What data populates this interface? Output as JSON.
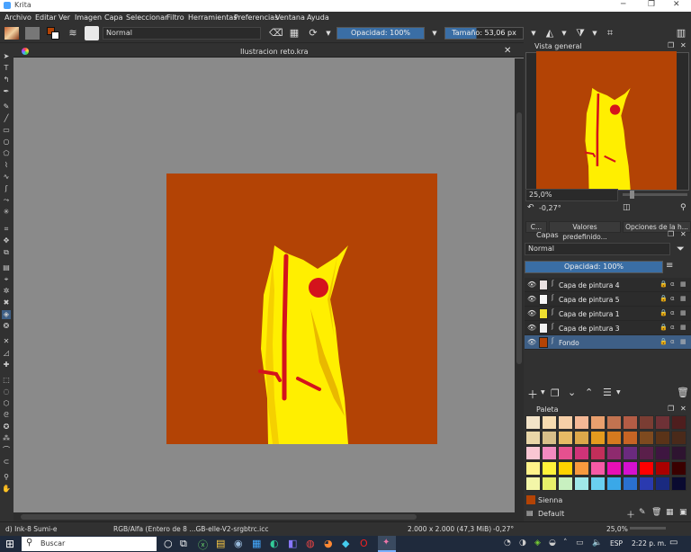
{
  "app": {
    "title": "Krita"
  },
  "menu": [
    "Archivo",
    "Editar",
    "Ver",
    "Imagen",
    "Capa",
    "Seleccionar",
    "Filtro",
    "Herramientas",
    "Preferencias",
    "Ventana",
    "Ayuda"
  ],
  "toolbar": {
    "blend_mode": "Normal",
    "opacity": "Opacidad: 100%",
    "size": "Tamaño: 53,06 px"
  },
  "document": {
    "tab_title": "Ilustracion reto.kra"
  },
  "overview": {
    "title": "Vista general",
    "zoom": "25,0%",
    "rotation": "-0,27°"
  },
  "dock_tabs": [
    "C...",
    "Valores predefinido...",
    "Opciones de la h..."
  ],
  "layers": {
    "title": "Capas",
    "blend": "Normal",
    "opacity": "Opacidad:  100%",
    "items": [
      {
        "name": "Capa de pintura 4",
        "thumb": "#e8e0e0"
      },
      {
        "name": "Capa de pintura 5",
        "thumb": "#f5f5f5"
      },
      {
        "name": "Capa de pintura 1",
        "thumb": "#f0e030"
      },
      {
        "name": "Capa de pintura 3",
        "thumb": "#f2f2f2"
      },
      {
        "name": "Fondo",
        "thumb": "#b34305"
      }
    ]
  },
  "palette": {
    "title": "Paleta",
    "selected_color_name": "Sienna",
    "selected_color": "#b34305",
    "name": "Default",
    "colors": [
      "#f2e3c8",
      "#f7dcb0",
      "#f6cfa8",
      "#f4b896",
      "#e9a06e",
      "#c27350",
      "#b35c45",
      "#7a3d33",
      "#6e3136",
      "#4e1e1e",
      "#e9d6a8",
      "#d8bf8a",
      "#e7ba65",
      "#dda84a",
      "#e59b1e",
      "#d57a1e",
      "#c76424",
      "#7e4a1f",
      "#5a3318",
      "#4a2a1a",
      "#f9c6d3",
      "#f28ac0",
      "#e6508f",
      "#d03378",
      "#c22e5a",
      "#8e2a6e",
      "#6a2a7e",
      "#5a1f4a",
      "#3e1640",
      "#2e1430",
      "#fff38a",
      "#fff33a",
      "#ffd300",
      "#f79a3e",
      "#f55aa6",
      "#e80fb5",
      "#d510d0",
      "#ff0000",
      "#aa0000",
      "#3a0000",
      "#f3f6a8",
      "#e8f06a",
      "#c8f0c0",
      "#a0e8e8",
      "#6ad0f0",
      "#3aa8e8",
      "#2a70d0",
      "#2a3ab0",
      "#1a2a80",
      "#0a0a30"
    ]
  },
  "status": {
    "brush": "d) Ink-8 Sumi-e",
    "color_space": "RGB/Alfa (Entero de 8 ...GB-elle-V2-srgbtrc.icc",
    "dimensions": "2.000 x 2.000 (47,3 MiB)",
    "rotation": "-0,27°",
    "zoom": "25,0%"
  },
  "taskbar": {
    "search": "Buscar",
    "lang": "ESP",
    "time": "2:22 p. m."
  }
}
